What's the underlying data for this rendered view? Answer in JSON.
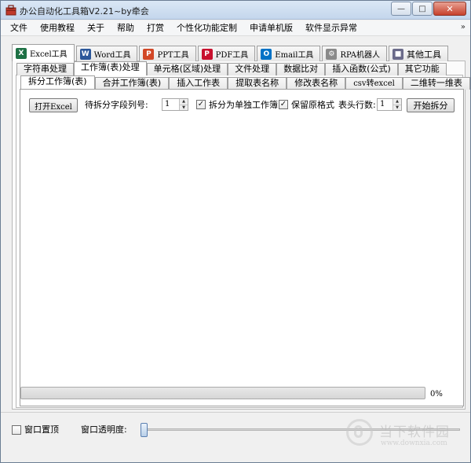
{
  "window": {
    "title": "办公自动化工具箱V2.21~by牵会",
    "minimize": "—",
    "maximize": "□",
    "close": "✕"
  },
  "menu": {
    "items": [
      "文件",
      "使用教程",
      "关于",
      "帮助",
      "打赏",
      "个性化功能定制",
      "申请单机版",
      "软件显示异常"
    ],
    "more": "»"
  },
  "tool_tabs": [
    {
      "label": "Excel工具",
      "icon": "excel-icon",
      "letter": "X",
      "color": "#1e7145"
    },
    {
      "label": "Word工具",
      "icon": "word-icon",
      "letter": "W",
      "color": "#2b579a"
    },
    {
      "label": "PPT工具",
      "icon": "ppt-icon",
      "letter": "P",
      "color": "#d24726"
    },
    {
      "label": "PDF工具",
      "icon": "pdf-icon",
      "letter": "P",
      "color": "#c8102e"
    },
    {
      "label": "Email工具",
      "icon": "email-icon",
      "letter": "O",
      "color": "#0072c6"
    },
    {
      "label": "RPA机器人",
      "icon": "robot-icon",
      "letter": "⚙",
      "color": "#8a8a8a"
    },
    {
      "label": "其他工具",
      "icon": "folder-icon",
      "letter": "■",
      "color": "#6b6b8a"
    }
  ],
  "category_tabs": [
    "字符串处理",
    "工作簿(表)处理",
    "单元格(区域)处理",
    "文件处理",
    "数据比对",
    "插入函数(公式)",
    "其它功能"
  ],
  "sub_tabs": [
    "拆分工作簿(表)",
    "合并工作簿(表)",
    "插入工作表",
    "提取表名称",
    "修改表名称",
    "csv转excel",
    "二维转一维表"
  ],
  "split": {
    "open_button": "打开Excel",
    "column_label": "待拆分字段列号:",
    "column_value": "1",
    "split_separate_label": "拆分为单独工作簿",
    "split_separate_checked": true,
    "keep_format_label": "保留原格式",
    "keep_format_checked": true,
    "header_rows_label": "表头行数:",
    "header_rows_value": "1",
    "start_button": "开始拆分",
    "check_mark": "✓"
  },
  "progress": {
    "value": 0,
    "text": "0%"
  },
  "bottom": {
    "topmost_label": "窗口置顶",
    "topmost_checked": false,
    "opacity_label": "窗口透明度:",
    "opacity_value": 0
  },
  "watermark": {
    "text": "当下软件园",
    "url": "www.downxia.com"
  },
  "colors": {
    "progress_fill": "#06b025",
    "title_bar": "#c4d6ec"
  }
}
